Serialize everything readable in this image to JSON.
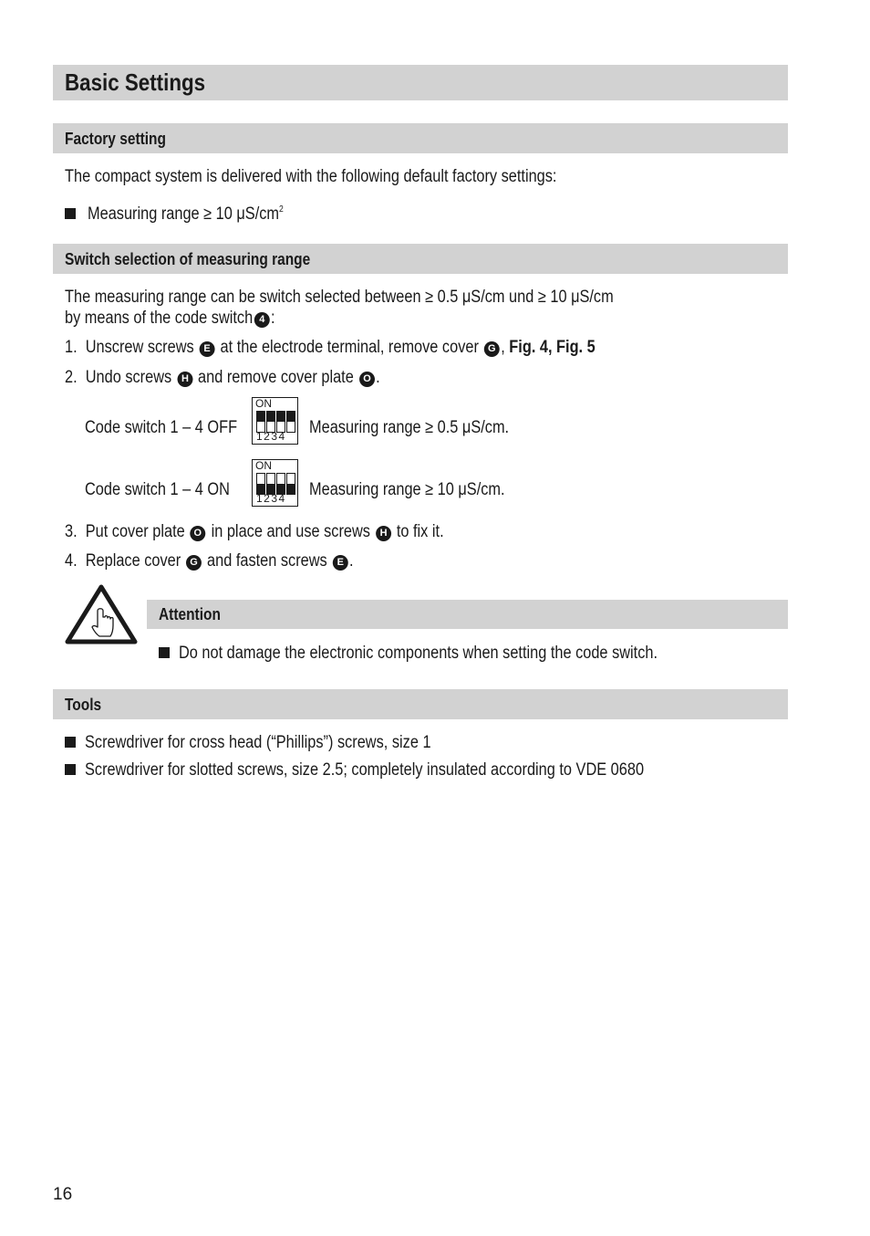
{
  "title": "Basic Settings",
  "factory": {
    "heading": "Factory setting",
    "intro": "The compact system is delivered with the following default factory settings:",
    "bullet_text": "Measuring range ≥ 10 μS/cm",
    "bullet_sup": "2"
  },
  "switch": {
    "heading": "Switch selection of measuring range",
    "intro_line1": "The measuring range can be switch selected between ≥ 0.5 μS/cm und ≥ 10 μS/cm",
    "intro_line2": "by means of the code switch",
    "intro_marker": "4",
    "intro_end": ":",
    "steps": [
      {
        "num": "1.",
        "parts": [
          "Unscrew screws",
          "E",
          "at the electrode terminal, remove cover",
          "G",
          ",",
          "Fig. 4, Fig. 5"
        ]
      },
      {
        "num": "2.",
        "parts": [
          "Undo screws",
          "H",
          "and remove cover plate",
          "O",
          "."
        ]
      },
      {
        "num": "3.",
        "parts": [
          "Put cover plate",
          "O",
          "in place and use screws",
          "H",
          "to fix it."
        ]
      },
      {
        "num": "4.",
        "parts": [
          "Replace cover",
          "G",
          "and fasten screws",
          "E",
          "."
        ]
      }
    ],
    "code_off": {
      "label": "Code switch 1 – 4 OFF",
      "result": "Measuring range ≥ 0.5 μS/cm.",
      "switch_positions": [
        "off",
        "off",
        "off",
        "off"
      ]
    },
    "code_on": {
      "label": "Code switch 1 – 4 ON",
      "result": "Measuring range ≥ 10 μS/cm.",
      "switch_positions": [
        "on",
        "on",
        "on",
        "on"
      ]
    },
    "dip_on_label": "ON",
    "dip_numbers": "1234"
  },
  "attention": {
    "icon": "warning-hand-icon",
    "heading": "Attention",
    "bullet": "Do not damage the electronic components when setting the code switch."
  },
  "tools": {
    "heading": "Tools",
    "items": [
      "Screwdriver for cross head (“Phillips”) screws, size 1",
      "Screwdriver for slotted screws, size 2.5; completely insulated according to VDE 0680"
    ]
  },
  "page_number": "16"
}
